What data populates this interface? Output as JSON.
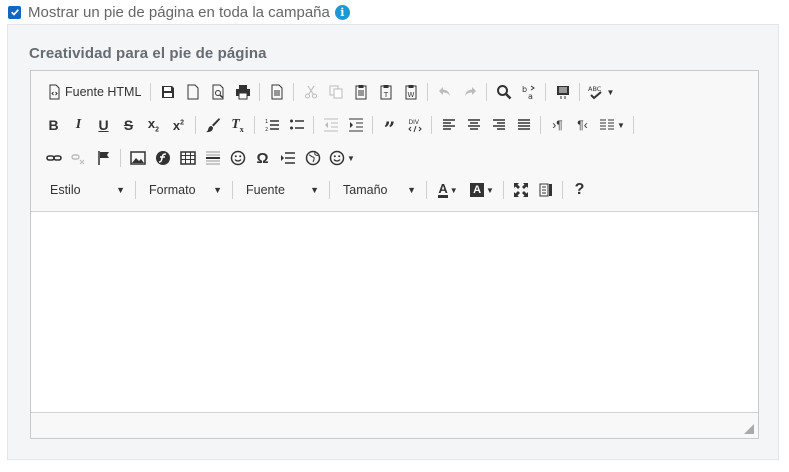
{
  "footer_toggle": {
    "checked": true,
    "label": "Mostrar un pie de página en toda la campaña",
    "info_icon": "info-icon"
  },
  "footer_creative": {
    "label": "Creatividad para el pie de página"
  },
  "toolbar": {
    "source_button": "Fuente HTML",
    "combos": {
      "style": "Estilo",
      "format": "Formato",
      "font": "Fuente",
      "size": "Tamaño"
    }
  },
  "colors": {
    "accent": "#1565c0",
    "info": "#1a9ad2"
  }
}
